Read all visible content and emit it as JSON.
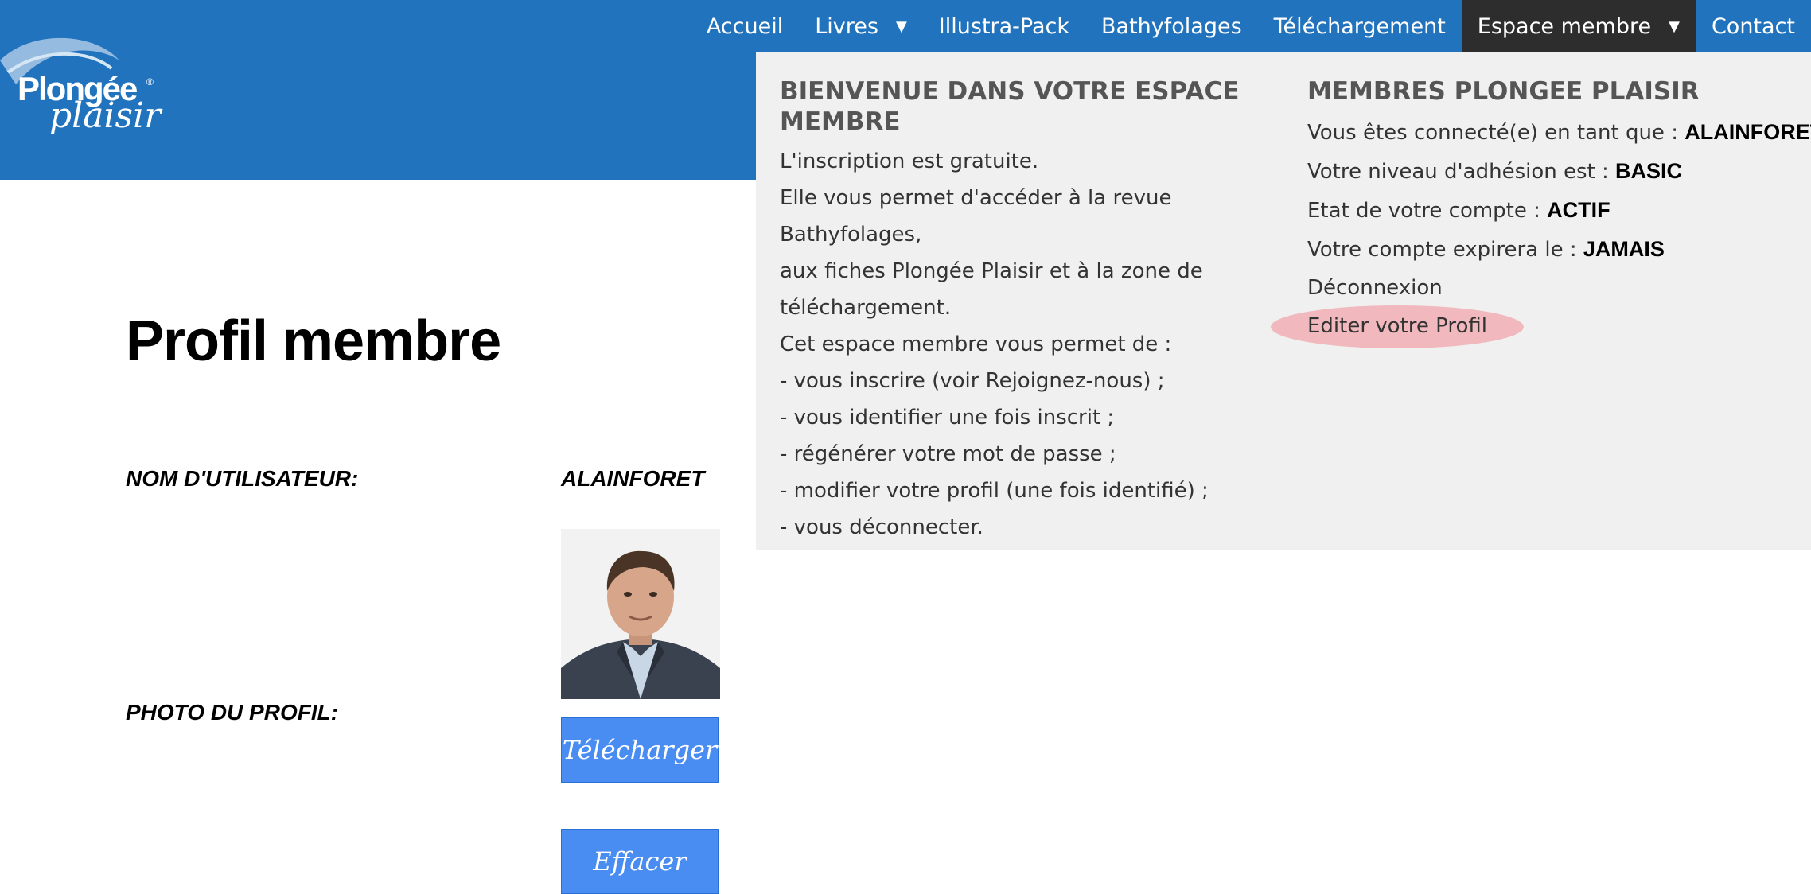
{
  "logo": {
    "brand_line1": "Plongée",
    "brand_line2": "plaisir"
  },
  "nav": {
    "items": [
      {
        "label": "Accueil"
      },
      {
        "label": "Livres",
        "has_dropdown": true
      },
      {
        "label": "Illustra-Pack"
      },
      {
        "label": "Bathyfolages"
      },
      {
        "label": "Téléchargement"
      },
      {
        "label": "Espace membre",
        "has_dropdown": true,
        "active": true
      },
      {
        "label": "Contact"
      }
    ]
  },
  "dropdown": {
    "left": {
      "heading": "BIENVENUE DANS VOTRE ESPACE MEMBRE",
      "lines": [
        "L'inscription est gratuite.",
        "Elle vous permet d'accéder à la revue Bathyfolages,",
        "aux fiches Plongée Plaisir et à la zone de",
        "téléchargement.",
        "Cet espace membre vous permet de :",
        "- vous inscrire (voir Rejoignez-nous) ;",
        "- vous identifier une fois inscrit ;",
        "- régénérer votre mot de passe ;",
        "- modifier votre profil (une fois identifié) ;",
        "- vous déconnecter."
      ]
    },
    "right": {
      "heading": "MEMBRES PLONGEE PLAISIR",
      "rows": [
        {
          "label": "Vous êtes connecté(e) en tant que : ",
          "value": "ALAINFORET"
        },
        {
          "label": "Votre niveau d'adhésion est : ",
          "value": "BASIC"
        },
        {
          "label": "Etat de votre compte : ",
          "value": "ACTIF"
        },
        {
          "label": "Votre compte expirera le : ",
          "value": "JAMAIS"
        }
      ],
      "logout": "Déconnexion",
      "edit_profile": "Editer votre Profil"
    }
  },
  "page": {
    "title": "Profil membre",
    "username_label": "NOM D'UTILISATEUR:",
    "username_value": "ALAINFORET",
    "photo_label": "PHOTO DU PROFIL:",
    "upload_button": "Télécharger",
    "delete_button": "Effacer"
  },
  "colors": {
    "header_blue": "#2173bd",
    "active_nav": "#2d2d2d",
    "dropdown_bg": "#f0f0f0",
    "button_blue": "#4a8df2",
    "highlight": "#f1b9bd"
  }
}
